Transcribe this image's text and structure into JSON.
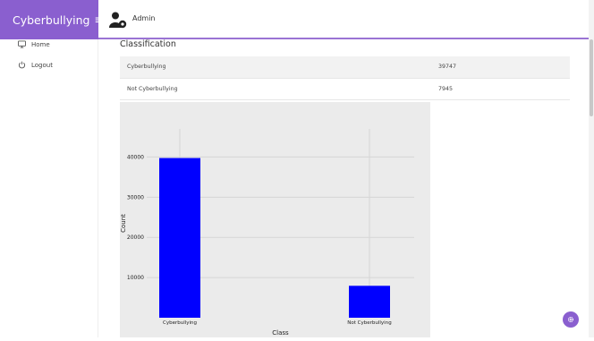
{
  "app": {
    "brand": "Cyberbullying",
    "menu_icon": "≡"
  },
  "header": {
    "user_name": "Admin",
    "user_icon": "admin-user-icon"
  },
  "sidebar": {
    "items": [
      {
        "label": "Home",
        "icon": "monitor-icon"
      },
      {
        "label": "Logout",
        "icon": "power-icon"
      }
    ]
  },
  "main": {
    "title": "Classification",
    "table": [
      {
        "label": "Cyberbullying",
        "value": "39747"
      },
      {
        "label": "Not Cyberbullying",
        "value": "7945"
      }
    ]
  },
  "chart_data": {
    "type": "bar",
    "categories": [
      "Cyberbullying",
      "Not Cyberbullying"
    ],
    "values": [
      39747,
      7945
    ],
    "xlabel": "Class",
    "ylabel": "Count",
    "yticks": [
      10000,
      20000,
      30000,
      40000
    ],
    "ylim": [
      0,
      47000
    ],
    "bar_color": "#0000ff",
    "background": "#ebebeb",
    "grid": true
  },
  "colors": {
    "accent": "#8a5fcf"
  },
  "fab": {
    "icon": "gear-icon"
  }
}
